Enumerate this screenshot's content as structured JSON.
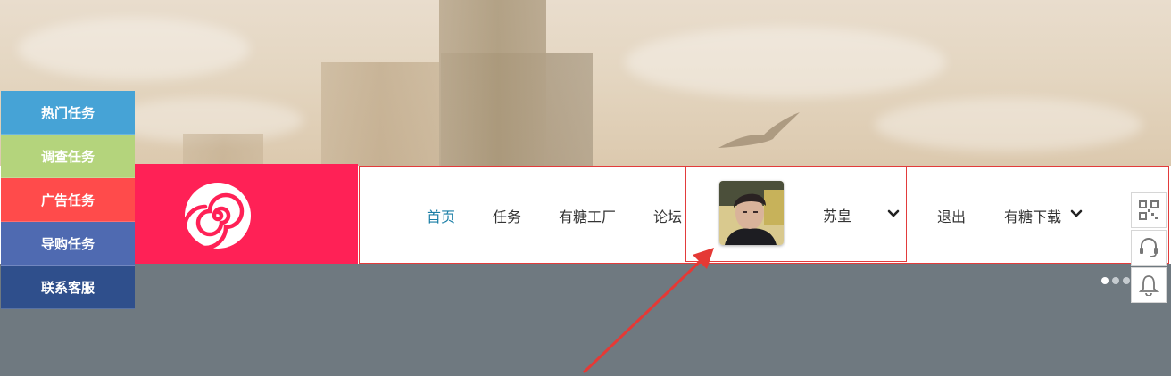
{
  "side_menu": {
    "items": [
      {
        "label": "热门任务",
        "color": "#46a3d6"
      },
      {
        "label": "调查任务",
        "color": "#b4d47c"
      },
      {
        "label": "广告任务",
        "color": "#ff4b4b"
      },
      {
        "label": "导购任务",
        "color": "#4f6ab1"
      },
      {
        "label": "联系客服",
        "color": "#2f4f8c"
      }
    ]
  },
  "brand": {
    "logo_icon": "swirl-logo-icon",
    "color": "#ff2156"
  },
  "nav": {
    "home": "首页",
    "tasks": "任务",
    "factory": "有糖工厂",
    "forum": "论坛",
    "username": "苏皇",
    "logout": "退出",
    "download": "有糖下载",
    "active_color": "#1a7ea6"
  },
  "tools": [
    "qr-code-icon",
    "headset-icon",
    "bell-icon"
  ],
  "carousel": {
    "active_index": 0
  }
}
